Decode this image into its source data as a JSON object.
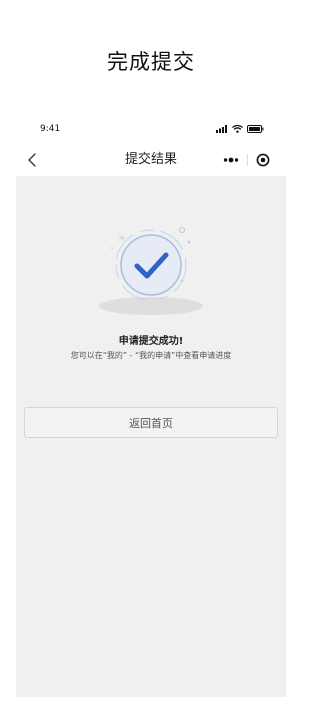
{
  "page_heading": "完成提交",
  "status_bar": {
    "time": "9:41",
    "icons": [
      "signal-icon",
      "wifi-icon",
      "battery-icon"
    ]
  },
  "navbar": {
    "title": "提交结果",
    "back_icon": "chevron-left-icon",
    "menu_icon": "more-dots-icon",
    "close_icon": "target-circle-icon"
  },
  "result": {
    "icon": "check-circle-icon",
    "title": "申请提交成功!",
    "description": "您可以在“我的” - “我的申请”中查看申请进度"
  },
  "actions": {
    "home_label": "返回首页"
  },
  "colors": {
    "accent": "#2f63c6",
    "content_bg": "#f0f0f0",
    "circle_fill": "#e6ebf5",
    "circle_ring": "#a9bde3"
  }
}
